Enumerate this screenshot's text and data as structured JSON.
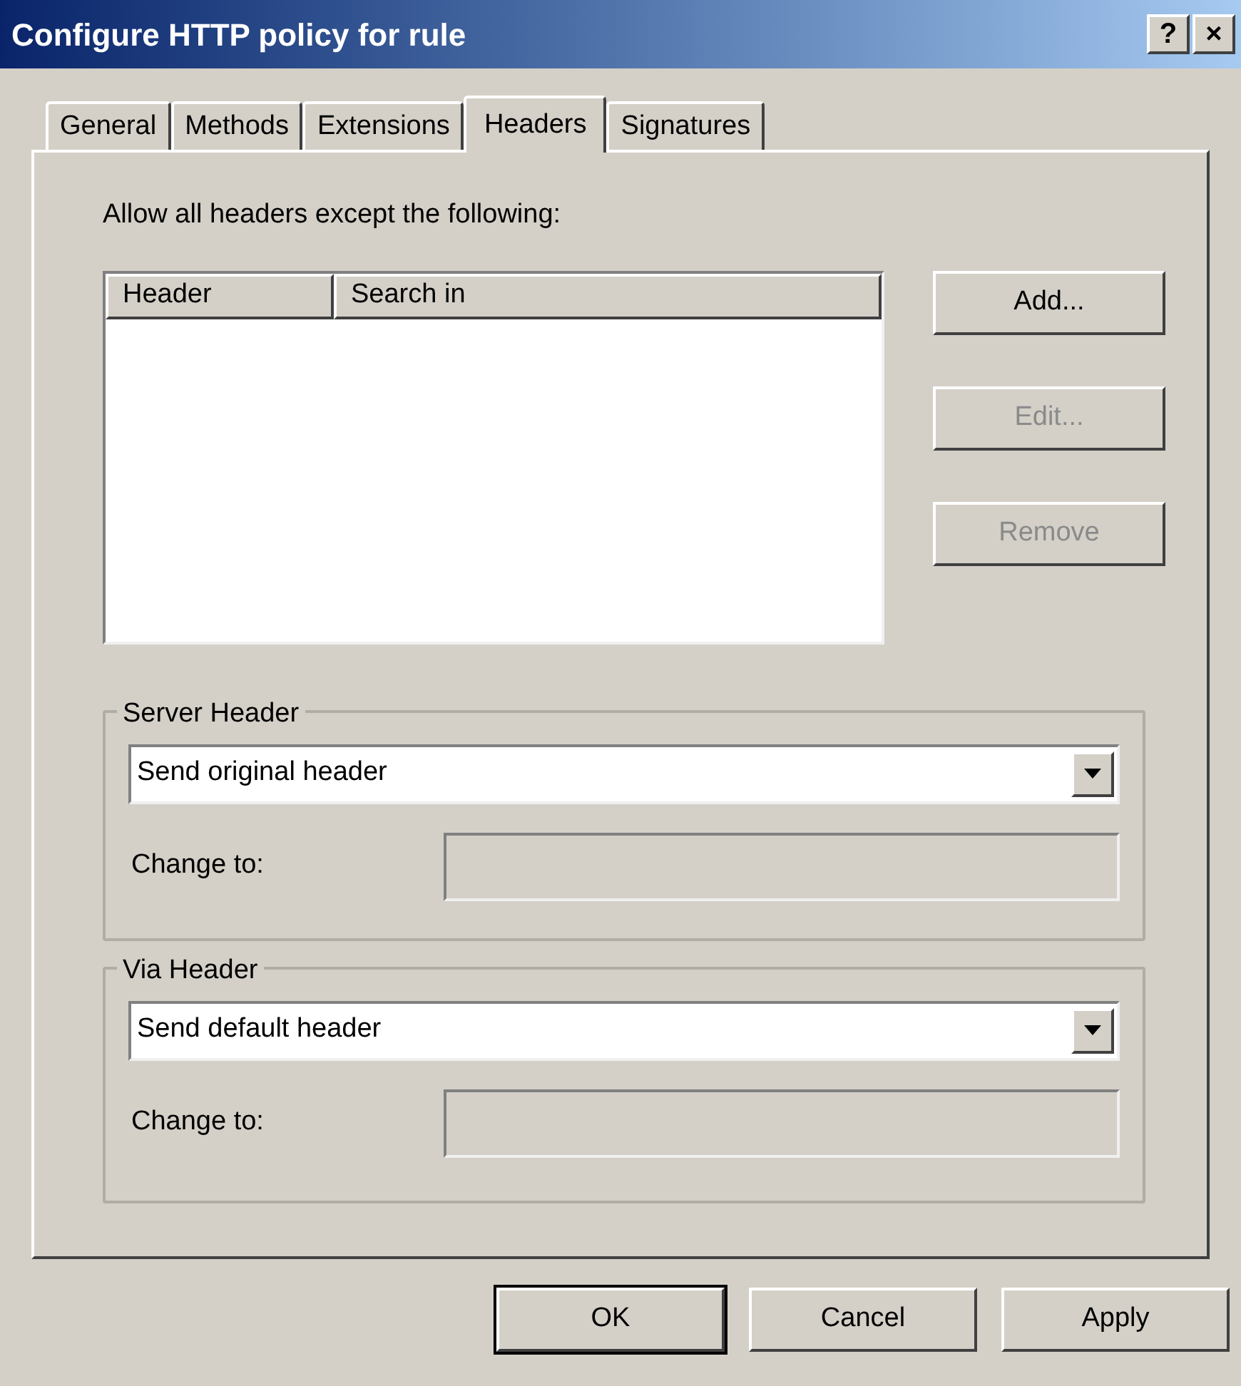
{
  "window": {
    "title": "Configure HTTP policy for rule",
    "controls": [
      "?",
      "×"
    ]
  },
  "tabs": [
    {
      "label": "General",
      "selected": false
    },
    {
      "label": "Methods",
      "selected": false
    },
    {
      "label": "Extensions",
      "selected": false
    },
    {
      "label": "Headers",
      "selected": true
    },
    {
      "label": "Signatures",
      "selected": false
    }
  ],
  "intro": "Allow all headers except the following:",
  "table": {
    "columns": [
      "Header",
      "Search in"
    ]
  },
  "side_buttons": [
    {
      "label": "Add...",
      "disabled": false
    },
    {
      "label": "Edit...",
      "disabled": true
    },
    {
      "label": "Remove",
      "disabled": true
    }
  ],
  "groups": [
    {
      "title": "Server Header",
      "select": "Send original header",
      "change_label": "Change to:",
      "change_disabled": true
    },
    {
      "title": "Via Header",
      "select": "Send default header",
      "change_label": "Change to:",
      "change_disabled": true
    }
  ],
  "buttons": [
    {
      "label": "OK",
      "default": true
    },
    {
      "label": "Cancel",
      "default": false
    },
    {
      "label": "Apply",
      "default": false
    }
  ]
}
